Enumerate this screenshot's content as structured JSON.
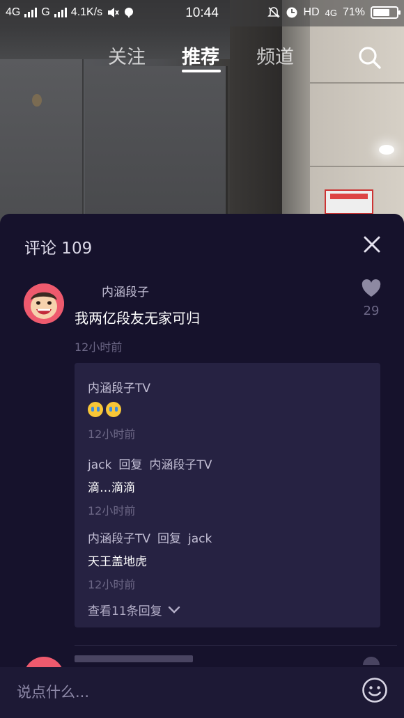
{
  "status_bar": {
    "network_1": "4G",
    "network_2": "G",
    "speed": "4.1K/s",
    "time": "10:44",
    "hd": "HD",
    "network_3": "4G",
    "battery_percent": "71%",
    "battery_level": 0.71
  },
  "top_tabs": {
    "tabs": [
      {
        "label": "关注",
        "active": false
      },
      {
        "label": "推荐",
        "active": true
      },
      {
        "label": "频道",
        "active": false
      }
    ]
  },
  "comments_sheet": {
    "header": "评论 109",
    "comment": {
      "author": "内涵段子",
      "text": "我两亿段友无家可归",
      "time": "12小时前",
      "likes": "29"
    },
    "replies": [
      {
        "author": "内涵段子TV",
        "reply_to": "",
        "reply_word": "",
        "text": "",
        "emoji": [
          "loudly-crying-face",
          "loudly-crying-face"
        ],
        "time": "12小时前"
      },
      {
        "author": "jack",
        "reply_word": "回复",
        "reply_to": "内涵段子TV",
        "text": "滴…滴滴",
        "time": "12小时前"
      },
      {
        "author": "内涵段子TV",
        "reply_word": "回复",
        "reply_to": "jack",
        "text": "天王盖地虎",
        "time": "12小时前"
      }
    ],
    "view_more": "查看11条回复"
  },
  "input_bar": {
    "placeholder": "说点什么..."
  },
  "colors": {
    "sheet_bg": "#16122c",
    "reply_box_bg": "#262242",
    "muted_text": "#6d6887",
    "avatar_bg": "#ee5a6e"
  }
}
